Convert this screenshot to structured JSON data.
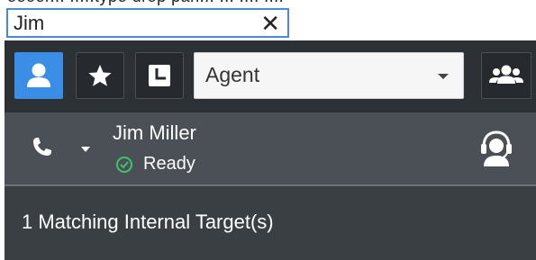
{
  "search": {
    "value": "Jim",
    "clear_icon": "close-icon"
  },
  "toolbar": {
    "buttons": [
      {
        "icon": "person-icon",
        "active": true
      },
      {
        "icon": "star-icon",
        "active": false
      },
      {
        "icon": "history-icon",
        "active": false
      }
    ],
    "filter_select": {
      "value": "Agent"
    },
    "team_icon": "group-icon"
  },
  "contact": {
    "name": "Jim Miller",
    "status": "Ready",
    "status_color": "#3ec46d",
    "call_icon": "phone-icon",
    "agent_icon": "headset-agent-icon"
  },
  "results": {
    "summary": "1 Matching Internal Target(s)"
  },
  "colors": {
    "accent": "#3b8ee5",
    "panel_dark": "#2c3136",
    "panel_mid": "#4a5055"
  }
}
